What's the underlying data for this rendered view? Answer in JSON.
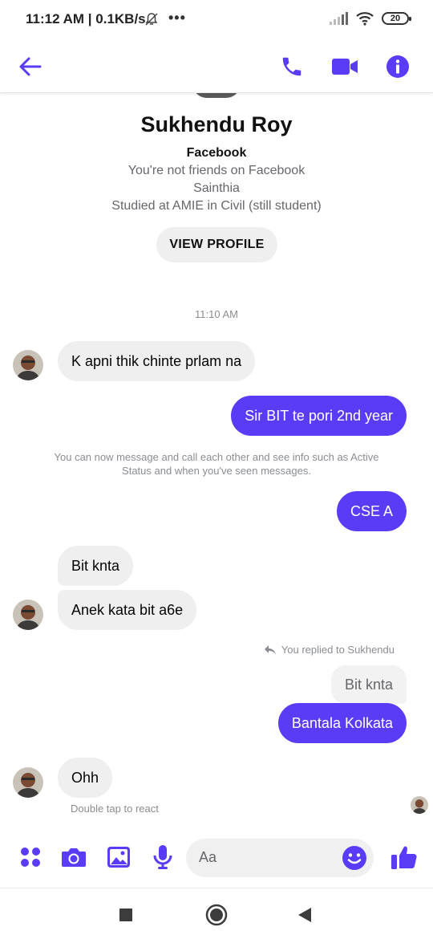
{
  "status_bar": {
    "time": "11:12 AM | 0.1KB/s",
    "battery": "20"
  },
  "header": {
    "icons": [
      "back-arrow-icon",
      "phone-icon",
      "video-icon",
      "info-icon"
    ]
  },
  "colors": {
    "accent": "#5b3cf6",
    "incoming_bubble": "#efefef",
    "muted_text": "#8a8d91"
  },
  "profile": {
    "name": "Sukhendu Roy",
    "platform": "Facebook",
    "friend_status": "You're not friends on Facebook",
    "location": "Sainthia",
    "education": "Studied at AMIE in Civil (still student)",
    "view_profile_label": "VIEW PROFILE"
  },
  "chat": {
    "timestamp": "11:10 AM",
    "messages": [
      {
        "from": "them",
        "text": "K apni thik chinte prlam na"
      },
      {
        "from": "me",
        "text": "Sir BIT te pori 2nd year"
      },
      {
        "from": "me",
        "text": "CSE A"
      },
      {
        "from": "them",
        "text": "Bit knta"
      },
      {
        "from": "them",
        "text": "Anek kata bit a6e"
      },
      {
        "from": "me",
        "text": "Bantala Kolkata"
      },
      {
        "from": "them",
        "text": "Ohh"
      }
    ],
    "system_note": "You can now message and call each other and see info such as Active Status and when you've seen messages.",
    "reply_note": "You replied to Sukhendu",
    "quoted_text": "Bit knta",
    "react_hint": "Double tap to react"
  },
  "composer": {
    "placeholder": "Aa",
    "icons": [
      "menu-dots-icon",
      "camera-icon",
      "gallery-icon",
      "microphone-icon",
      "emoji-icon",
      "thumbs-up-icon"
    ]
  },
  "nav_bar": {
    "icons": [
      "recents-square-icon",
      "home-circle-icon",
      "back-triangle-icon"
    ]
  }
}
